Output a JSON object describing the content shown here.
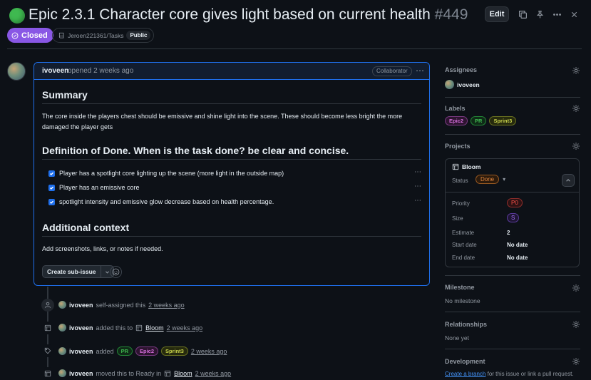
{
  "issue": {
    "title": "Epic 2.3.1 Character core gives light based on current health",
    "number": "#449",
    "state": "Closed",
    "repo": "Jeroen221361/Tasks",
    "visibility": "Public"
  },
  "header_actions": {
    "edit_label": "Edit",
    "icons": [
      "copy-icon",
      "pin-icon",
      "more-icon",
      "close-icon"
    ]
  },
  "comment": {
    "author": "ivoveen",
    "action": "opened 2 weeks ago",
    "role_badge": "Collaborator",
    "summary_heading": "Summary",
    "summary_text": "The core inside the players chest should be emissive and shine light into the scene. These should become less bright the more damaged the player gets",
    "dod_heading": "Definition of Done. When is the task done? be clear and concise.",
    "tasks": [
      {
        "text": "Player has a spotlight core lighting up the scene (more light in the outside map)",
        "checked": true
      },
      {
        "text": "Player has an emissive core",
        "checked": true
      },
      {
        "text": "spotlight intensity and emissive glow decrease based on health percentage.",
        "checked": true
      }
    ],
    "context_heading": "Additional context",
    "context_text": "Add screenshots, links, or notes if needed.",
    "create_sub_issue_label": "Create sub-issue"
  },
  "timeline": [
    {
      "user": "ivoveen",
      "action": "self-assigned this",
      "time": "2 weeks ago",
      "icon": "person-icon"
    },
    {
      "user": "ivoveen",
      "action": "added this to",
      "project": "Bloom",
      "time": "2 weeks ago",
      "icon": "table-icon"
    },
    {
      "user": "ivoveen",
      "action": "added",
      "labels": [
        "PR",
        "Epic2",
        "Sprint3"
      ],
      "time": "2 weeks ago",
      "icon": "tag-icon"
    },
    {
      "user": "ivoveen",
      "action": "moved this to Ready in",
      "project": "Bloom",
      "time": "2 weeks ago",
      "icon": "table-icon"
    }
  ],
  "sidebar": {
    "assignees": {
      "title": "Assignees",
      "user": "ivoveen"
    },
    "labels": {
      "title": "Labels",
      "items": [
        "Epic2",
        "PR",
        "Sprint3"
      ]
    },
    "projects": {
      "title": "Projects",
      "name": "Bloom",
      "status_key": "Status",
      "status_value": "Done",
      "fields": [
        {
          "key": "Priority",
          "value": "P0"
        },
        {
          "key": "Size",
          "value": "S"
        },
        {
          "key": "Estimate",
          "value": "2"
        },
        {
          "key": "Start date",
          "value": "No date"
        },
        {
          "key": "End date",
          "value": "No date"
        }
      ]
    },
    "milestone": {
      "title": "Milestone",
      "value": "No milestone"
    },
    "relationships": {
      "title": "Relationships",
      "value": "None yet"
    },
    "development": {
      "title": "Development",
      "link": "Create a branch",
      "text": " for this issue or link a pull request."
    }
  },
  "colors": {
    "closed": "#8957e5",
    "open_dot": "#3fb950",
    "accent": "#1f6feb",
    "background": "#0d1117"
  }
}
